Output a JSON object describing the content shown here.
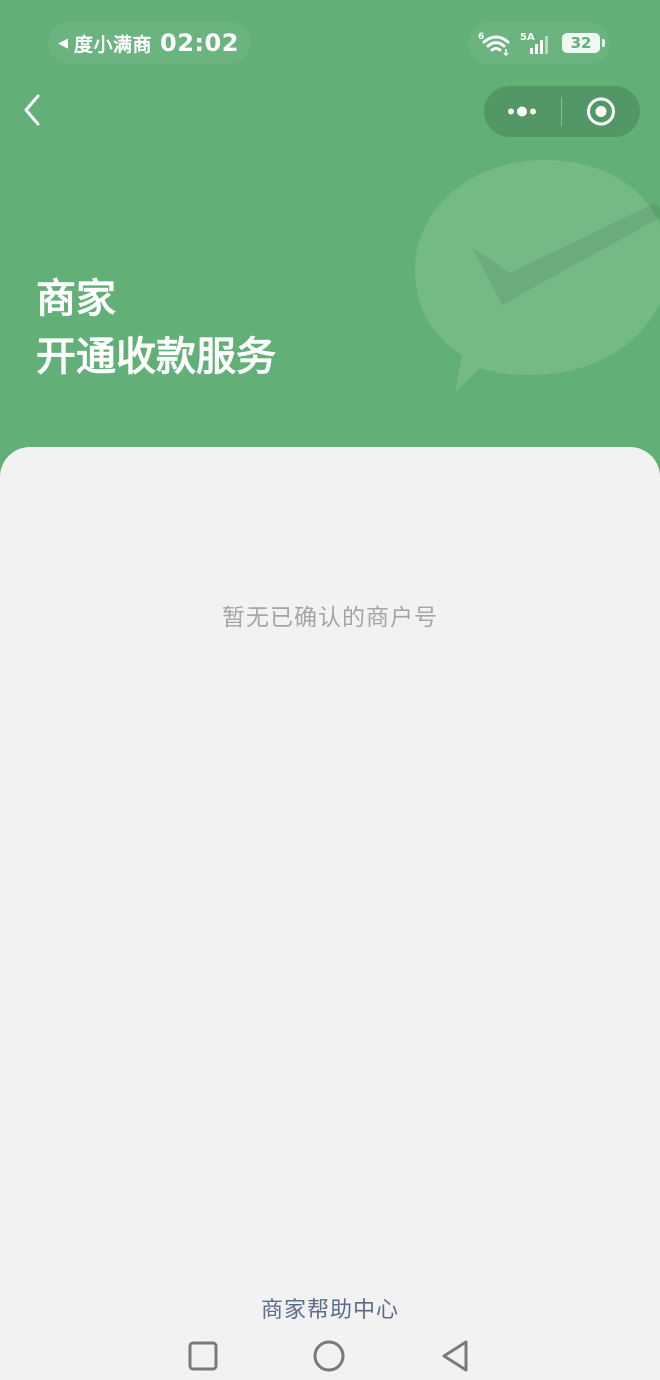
{
  "status_bar": {
    "back_app_name": "度小满商",
    "time": "02:02",
    "wifi_label": "6",
    "signal_label": "5A",
    "battery": "32"
  },
  "header": {
    "line1": "商家",
    "line2": "开通收款服务",
    "bg_color": "#62b077"
  },
  "content": {
    "empty_text": "暂无已确认的商户号"
  },
  "footer": {
    "help_link": "商家帮助中心"
  },
  "icons": {
    "nav_back": "chevron-left-icon",
    "more": "more-dots-icon",
    "close": "target-close-icon",
    "watermark": "wechat-pay-check-icon",
    "system_nav": [
      "square-recent-icon",
      "circle-home-icon",
      "triangle-back-icon"
    ]
  }
}
